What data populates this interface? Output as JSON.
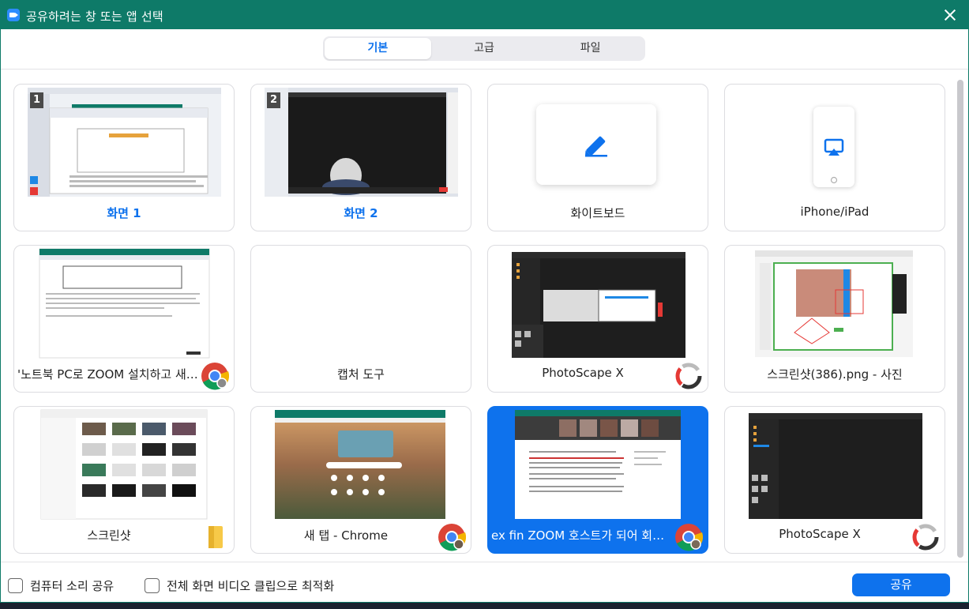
{
  "window": {
    "title": "공유하려는 창 또는 앱 선택"
  },
  "tabs": [
    {
      "label": "기본",
      "active": true
    },
    {
      "label": "고급",
      "active": false
    },
    {
      "label": "파일",
      "active": false
    }
  ],
  "cards": [
    {
      "label": "화면 1",
      "badge": "1"
    },
    {
      "label": "화면 2",
      "badge": "2"
    },
    {
      "label": "화이트보드"
    },
    {
      "label": "iPhone/iPad"
    },
    {
      "label": "'노트북 PC로 ZOOM 설치하고 새 ...",
      "icon": "chrome-icon"
    },
    {
      "label": "캡처 도구"
    },
    {
      "label": "PhotoScape X",
      "icon": "photoscape-icon"
    },
    {
      "label": "스크린샷(386).png - 사진"
    },
    {
      "label": "스크린샷",
      "icon": "folder-icon"
    },
    {
      "label": "새 탭 - Chrome",
      "icon": "chrome-icon"
    },
    {
      "label": "ex fin ZOOM 호스트가 되어 회의 ...",
      "icon": "chrome-icon",
      "selected": true
    },
    {
      "label": "PhotoScape X",
      "icon": "photoscape-icon"
    }
  ],
  "footer": {
    "share_audio": "컴퓨터 소리 공유",
    "optimize_video": "전체 화면 비디오 클립으로 최적화",
    "share_button": "공유"
  },
  "colors": {
    "title_bar": "#0e7a68",
    "accent": "#0e72ed"
  }
}
